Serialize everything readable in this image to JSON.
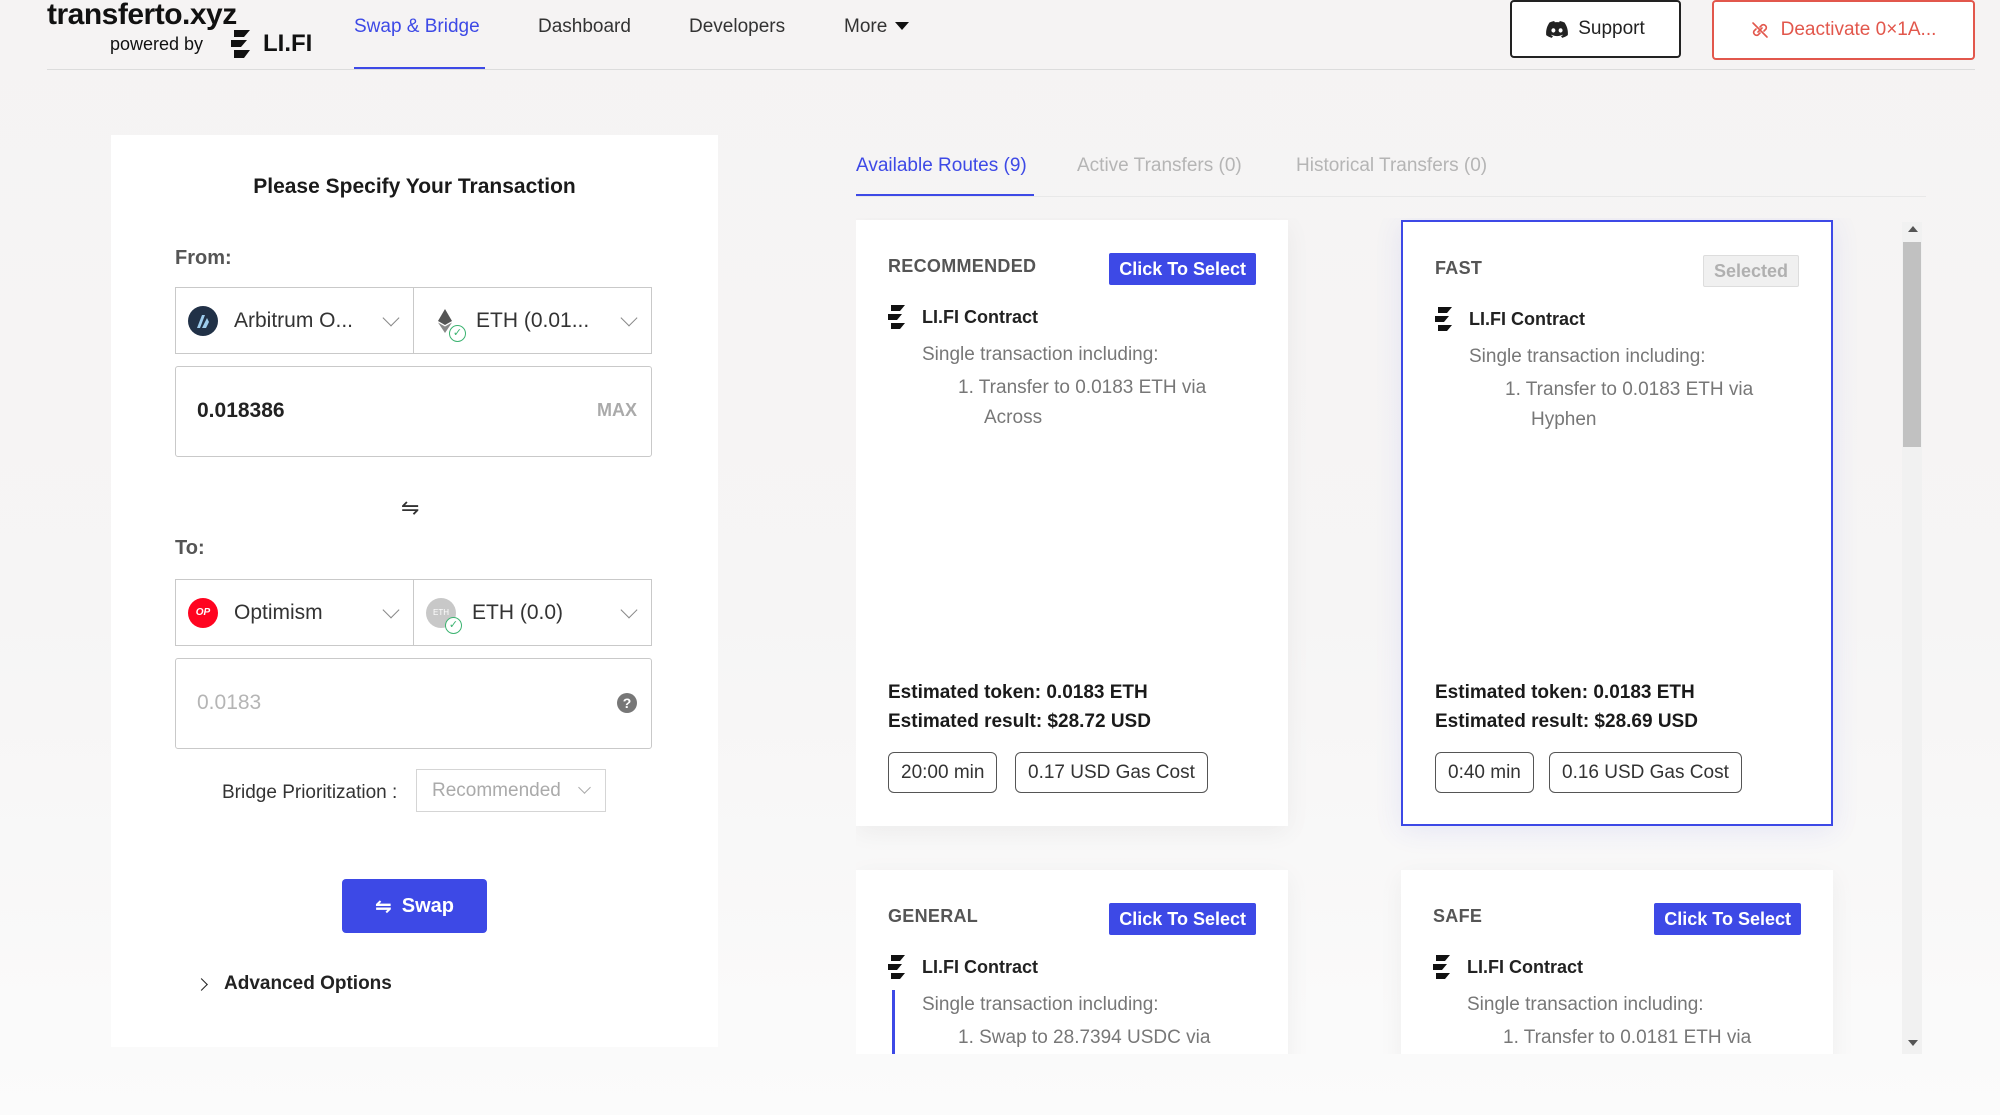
{
  "header": {
    "logo_title": "transferto.xyz",
    "powered_by": "powered by",
    "lifi": "LI.FI",
    "nav": [
      {
        "label": "Swap & Bridge",
        "active": true
      },
      {
        "label": "Dashboard",
        "active": false
      },
      {
        "label": "Developers",
        "active": false
      },
      {
        "label": "More",
        "active": false
      }
    ],
    "support_label": "Support",
    "deactivate_label": "Deactivate 0×1A...",
    "accent_color": "#3d49e6",
    "danger_color": "#e2574c"
  },
  "form": {
    "title": "Please Specify Your Transaction",
    "from_label": "From:",
    "from_chain": "Arbitrum O...",
    "from_token": "ETH (0.01...",
    "from_amount": "0.018386",
    "max_label": "MAX",
    "swap_direction_icon": "⇋",
    "to_label": "To:",
    "to_chain": "Optimism",
    "to_chain_icon_text": "OP",
    "to_token": "ETH (0.0)",
    "to_token_icon_text": "ETH",
    "to_amount": "0.0183",
    "help_icon": "?",
    "bridge_prioritization_label": "Bridge Prioritization :",
    "bridge_prioritization_value": "Recommended",
    "swap_button": "Swap",
    "advanced_options": "Advanced Options"
  },
  "tabs": [
    {
      "label": "Available Routes (9)",
      "active": true
    },
    {
      "label": "Active Transfers (0)",
      "active": false
    },
    {
      "label": "Historical Transfers (0)",
      "active": false
    }
  ],
  "routes": [
    {
      "tag": "RECOMMENDED",
      "action": "Click To Select",
      "contract": "LI.FI Contract",
      "desc": "Single transaction including:",
      "step": "1.  Transfer to 0.0183 ETH via Across",
      "est_token": "Estimated token: 0.0183 ETH",
      "est_result": "Estimated result: $28.72 USD",
      "time": "20:00 min",
      "gas": "0.17 USD Gas Cost"
    },
    {
      "tag": "FAST",
      "action": "Selected",
      "contract": "LI.FI Contract",
      "desc": "Single transaction including:",
      "step": "1.  Transfer to 0.0183 ETH via Hyphen",
      "est_token": "Estimated token: 0.0183 ETH",
      "est_result": "Estimated result: $28.69 USD",
      "time": "0:40 min",
      "gas": "0.16 USD Gas Cost"
    },
    {
      "tag": "GENERAL",
      "action": "Click To Select",
      "contract": "LI.FI Contract",
      "desc": "Single transaction including:",
      "step": "1.  Swap to 28.7394 USDC via"
    },
    {
      "tag": "SAFE",
      "action": "Click To Select",
      "contract": "LI.FI Contract",
      "desc": "Single transaction including:",
      "step": "1.  Transfer to 0.0181 ETH via"
    }
  ]
}
